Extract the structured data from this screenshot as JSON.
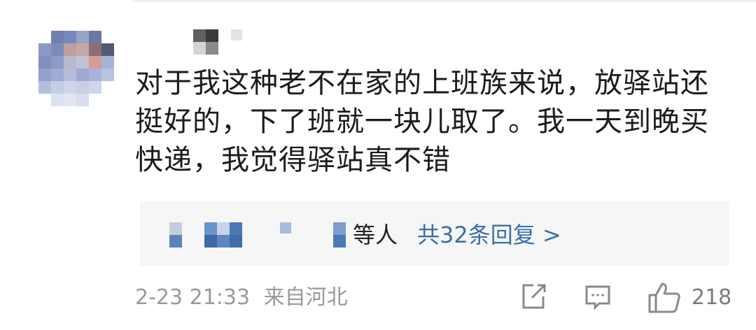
{
  "comment": {
    "text": "对于我这种老不在家的上班族来说，放驿站还挺好的，下了班就一块儿取了。我一天到晚买快递，我觉得驿站真不错"
  },
  "replies": {
    "people_suffix": "等人",
    "link_label": "共32条回复 >"
  },
  "meta": {
    "timestamp": "2-23 21:33",
    "location": "来自河北"
  },
  "actions": {
    "share_icon": "share-icon",
    "comment_icon": "comment-icon",
    "like_icon": "thumbs-up-icon",
    "like_count": "218"
  },
  "colors": {
    "link": "#3b6ea8",
    "meta": "#9a9a9a",
    "reply_bg": "#f6f6f6"
  }
}
